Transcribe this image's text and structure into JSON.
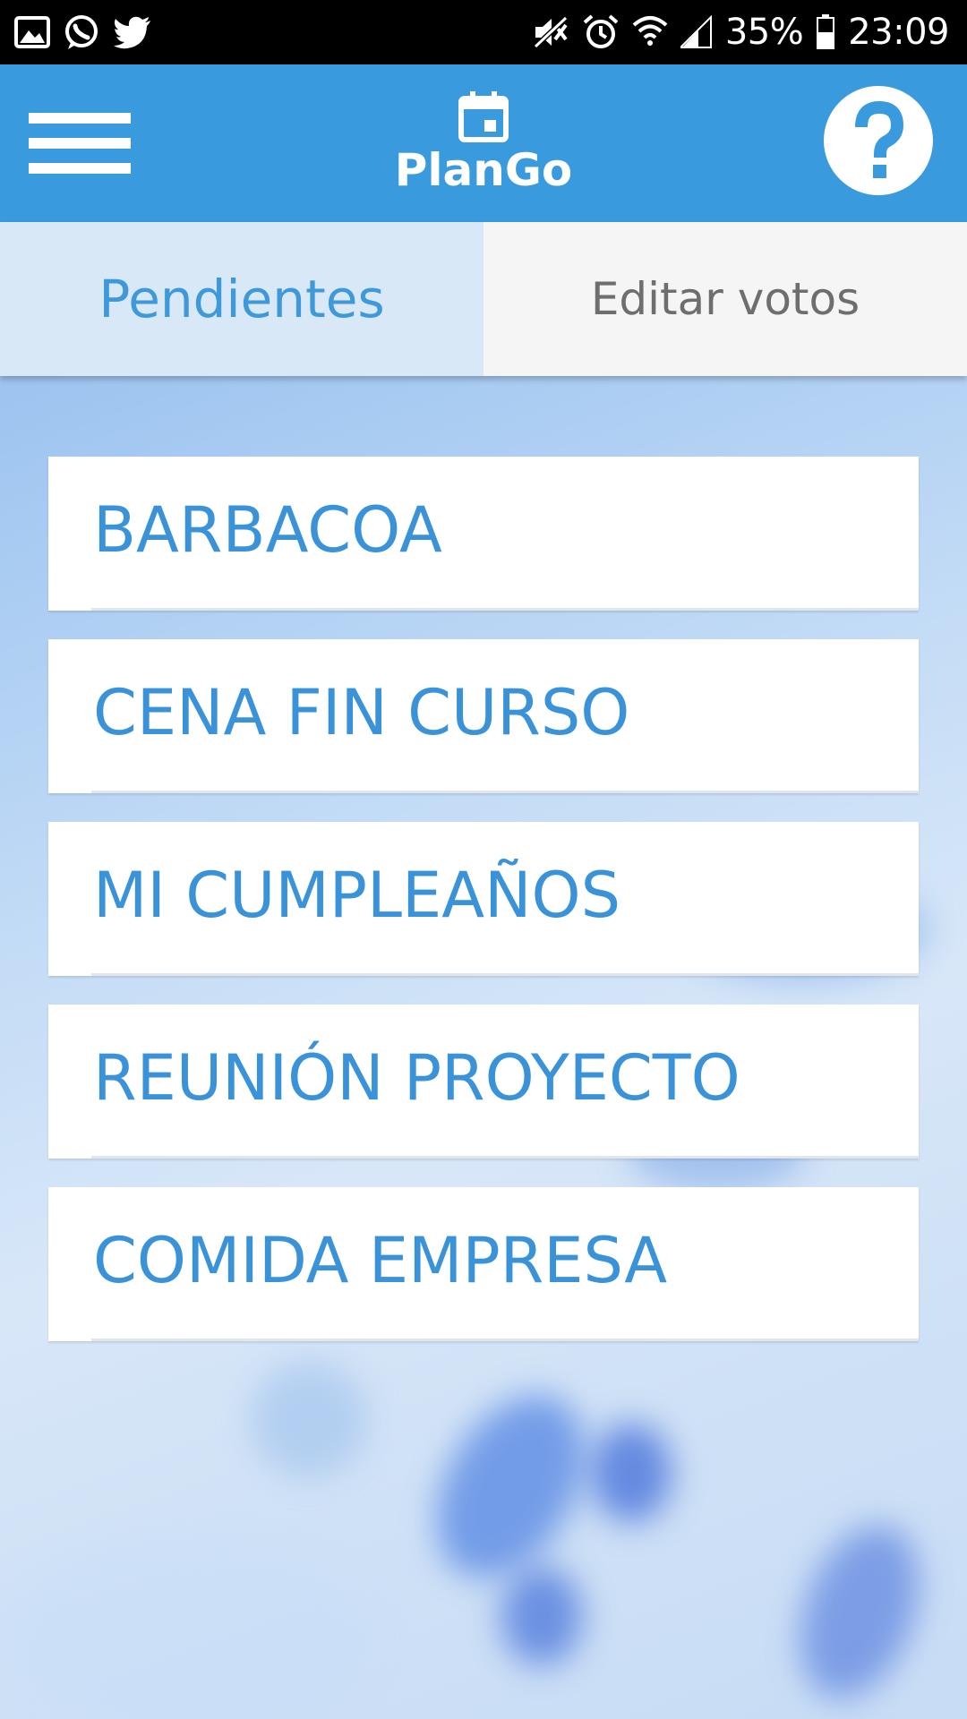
{
  "status_bar": {
    "left_icons": [
      "image-icon",
      "whatsapp-icon",
      "twitter-icon"
    ],
    "right_icons": [
      "mute-icon",
      "alarm-icon",
      "wifi-icon",
      "signal-icon",
      "battery-icon"
    ],
    "battery_level": "35%",
    "time": "23:09"
  },
  "app_bar": {
    "title": "PlanGo",
    "menu_icon": "hamburger-menu-icon",
    "logo_icon": "calendar-icon",
    "help_icon": "question-mark-icon",
    "color": "#3a9ade"
  },
  "tabs": [
    {
      "label": "Pendientes",
      "active": true
    },
    {
      "label": "Editar votos",
      "active": false
    }
  ],
  "plans": [
    {
      "label": "BARBACOA"
    },
    {
      "label": "CENA FIN CURSO"
    },
    {
      "label": "MI CUMPLEAÑOS"
    },
    {
      "label": "REUNIÓN PROYECTO"
    },
    {
      "label": "COMIDA EMPRESA"
    }
  ],
  "colors": {
    "accent": "#3a9ade",
    "item_text": "#3a92d8",
    "tab_active_bg": "#d8e8f6",
    "tab_inactive_bg": "#f5f5f5"
  }
}
